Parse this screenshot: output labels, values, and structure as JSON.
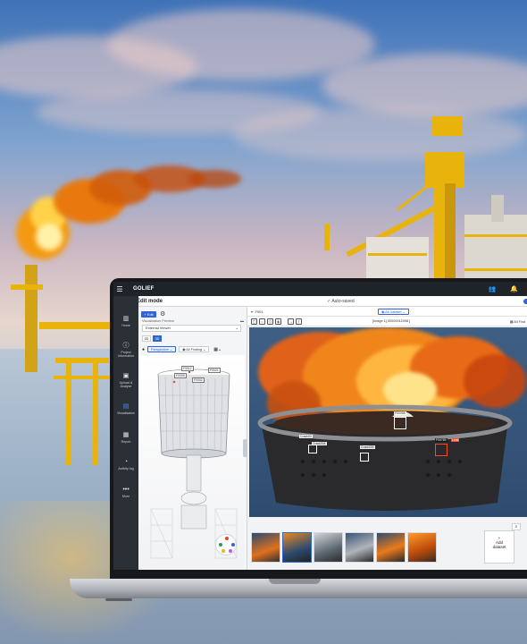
{
  "app": {
    "logo": "GOLIEF",
    "mode_title": "Edit mode",
    "autosave": "Auto-saved"
  },
  "nav": [
    {
      "label": "Home",
      "icon": "home-icon"
    },
    {
      "label": "Project Information",
      "icon": "info-icon"
    },
    {
      "label": "Upload & Analyse",
      "icon": "upload-icon"
    },
    {
      "label": "Visualisation",
      "icon": "visualisation-icon"
    },
    {
      "label": "Report",
      "icon": "report-icon"
    },
    {
      "label": "Activity log",
      "icon": "activity-icon"
    },
    {
      "label": "More",
      "icon": "more-icon"
    }
  ],
  "left_panel": {
    "edit_button": "+ Edit",
    "section_title": "Visualisation Preview",
    "view_select": "External Viewer",
    "seg_2d": "2D",
    "seg_3d": "3D",
    "perspective": "Perspective",
    "all_finding": "All Finding",
    "tags": [
      "F0012",
      "F0021",
      "F0009",
      "F0002"
    ]
  },
  "right_panel": {
    "finding_label": "F001",
    "dataset_pill": "All Dataset",
    "image_name": "[Image 1] 00000012098 ]",
    "all_findings": "All Find",
    "box_labels": [
      "F00098",
      "Crack03",
      "Crack004",
      "Crack005",
      "F00789",
      "Leak"
    ],
    "add_dataset_plus": "+",
    "add_dataset_line1": "Add",
    "add_dataset_line2": "dataset"
  },
  "colors": {
    "accent": "#2f63d6",
    "nav_bg": "#2b2f36",
    "alert": "#ff4a2f"
  }
}
